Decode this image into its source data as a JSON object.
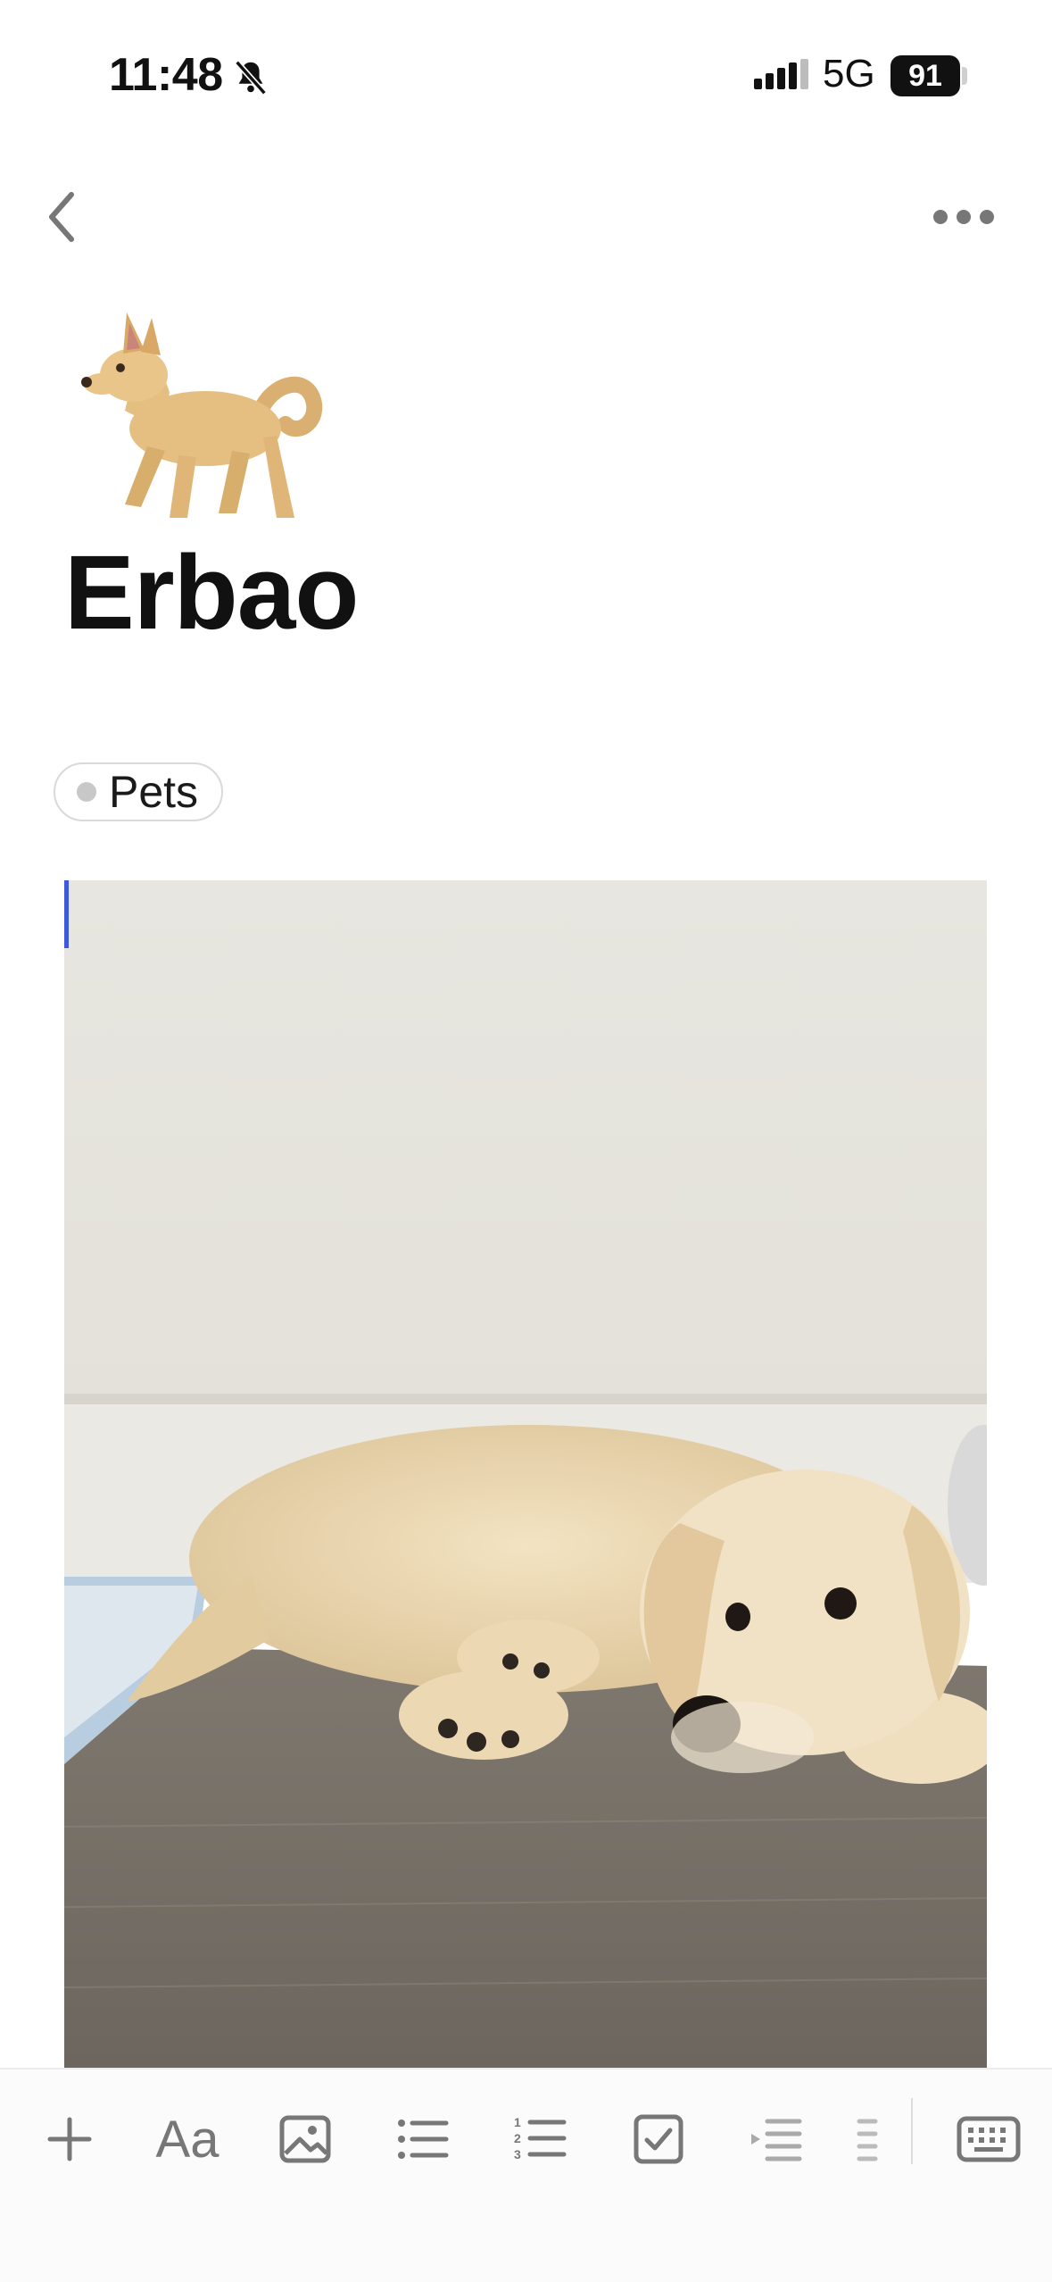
{
  "status_bar": {
    "time": "11:48",
    "network": "5G",
    "battery": "91"
  },
  "nav": {
    "back_icon": "chevron-left-icon",
    "more_icon": "ellipsis-icon"
  },
  "page": {
    "icon": "dog-emoji-icon",
    "title": "Erbao",
    "tag": "Pets"
  },
  "toolbar": {
    "items": [
      {
        "name": "add",
        "icon": "plus-icon"
      },
      {
        "name": "text-style",
        "icon": "text-style-icon",
        "label": "Aa"
      },
      {
        "name": "image",
        "icon": "image-icon"
      },
      {
        "name": "bulleted-list",
        "icon": "bulleted-list-icon"
      },
      {
        "name": "numbered-list",
        "icon": "numbered-list-icon"
      },
      {
        "name": "todo",
        "icon": "checkbox-icon"
      },
      {
        "name": "indent",
        "icon": "indent-icon"
      },
      {
        "name": "outdent",
        "icon": "outdent-icon"
      },
      {
        "name": "keyboard",
        "icon": "keyboard-icon"
      }
    ]
  },
  "colors": {
    "accent_cursor": "#3b5bdb",
    "icon_gray": "#777777",
    "title_text": "#111111"
  }
}
